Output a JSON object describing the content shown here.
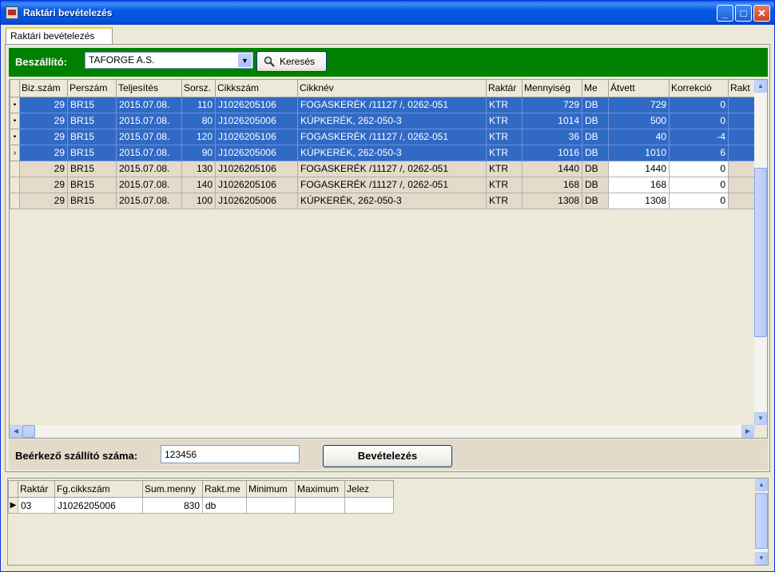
{
  "window": {
    "title": "Raktári bevételezés",
    "controls": {
      "minimize": "_",
      "maximize": "□",
      "close": "✕"
    }
  },
  "tab": {
    "label": "Raktári bevételezés"
  },
  "toolbar": {
    "supplier_label": "Beszállító:",
    "supplier_value": "TAFORGE A.S.",
    "search_label": "Keresés",
    "search_icon": "magnifier-icon",
    "accent_color": "#008000"
  },
  "main_grid": {
    "columns": [
      "Biz.szám",
      "Perszám",
      "Teljesítés",
      "Sorsz.",
      "Cikkszám",
      "Cikknév",
      "Raktár",
      "Mennyiség",
      "Me",
      "Átvett",
      "Korrekció",
      "Rakt"
    ],
    "rows": [
      {
        "marker": "•",
        "selected": true,
        "cells": [
          "29",
          "BR15",
          "2015.07.08.",
          "110",
          "J1026205106",
          "FOGASKERÉK /11127 /, 0262-051",
          "KTR",
          "729",
          "DB",
          "729",
          "0",
          ""
        ]
      },
      {
        "marker": "•",
        "selected": true,
        "cells": [
          "29",
          "BR15",
          "2015.07.08.",
          "80",
          "J1026205006",
          "KÚPKERÉK, 262-050-3",
          "KTR",
          "1014",
          "DB",
          "500",
          "0",
          ""
        ]
      },
      {
        "marker": "•",
        "selected": true,
        "cells": [
          "29",
          "BR15",
          "2015.07.08.",
          "120",
          "J1026205106",
          "FOGASKERÉK /11127 /, 0262-051",
          "KTR",
          "36",
          "DB",
          "40",
          "-4",
          ""
        ]
      },
      {
        "marker": "›",
        "selected": true,
        "cells": [
          "29",
          "BR15",
          "2015.07.08.",
          "90",
          "J1026205006",
          "KÚPKERÉK, 262-050-3",
          "KTR",
          "1016",
          "DB",
          "1010",
          "6",
          ""
        ]
      },
      {
        "marker": "",
        "selected": false,
        "cells": [
          "29",
          "BR15",
          "2015.07.08.",
          "130",
          "J1026205106",
          "FOGASKERÉK /11127 /, 0262-051",
          "KTR",
          "1440",
          "DB",
          "1440",
          "0",
          ""
        ]
      },
      {
        "marker": "",
        "selected": false,
        "cells": [
          "29",
          "BR15",
          "2015.07.08.",
          "140",
          "J1026205106",
          "FOGASKERÉK /11127 /, 0262-051",
          "KTR",
          "168",
          "DB",
          "168",
          "0",
          ""
        ]
      },
      {
        "marker": "",
        "selected": false,
        "cells": [
          "29",
          "BR15",
          "2015.07.08.",
          "100",
          "J1026205006",
          "KÚPKERÉK, 262-050-3",
          "KTR",
          "1308",
          "DB",
          "1308",
          "0",
          ""
        ]
      }
    ],
    "selection_color": "#316AC5"
  },
  "receipt": {
    "label": "Beérkező szállító száma:",
    "value": "123456",
    "submit_label": "Bevételezés"
  },
  "summary_grid": {
    "columns": [
      "Raktár",
      "Fg.cikkszám",
      "Sum.menny",
      "Rakt.me",
      "Minimum",
      "Maximum",
      "Jelez"
    ],
    "rows": [
      {
        "marker": "▶",
        "cells": [
          "03",
          "J1026205006",
          "830",
          "db",
          "",
          "",
          ""
        ]
      }
    ]
  }
}
